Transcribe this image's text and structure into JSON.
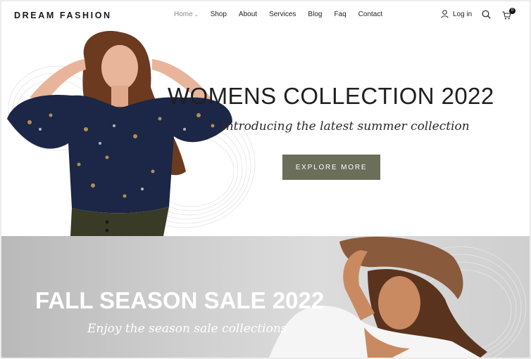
{
  "brand": {
    "name": "DREAM FASHION"
  },
  "nav": {
    "items": [
      {
        "label": "Home",
        "active": true
      },
      {
        "label": "Shop"
      },
      {
        "label": "About"
      },
      {
        "label": "Services"
      },
      {
        "label": "Blog"
      },
      {
        "label": "Faq"
      },
      {
        "label": "Contact"
      }
    ],
    "chevron": "⌄"
  },
  "header": {
    "login_label": "Log in",
    "cart_count": "0"
  },
  "hero": {
    "title": "WOMENS COLLECTION 2022",
    "subtitle": "Introducing the latest summer collection",
    "cta_label": "EXPLORE MORE"
  },
  "banner2": {
    "title": "FALL SEASON SALE 2022",
    "subtitle": "Enjoy the season sale collections"
  },
  "colors": {
    "accent": "#6b6e59",
    "text": "#1f1f1f",
    "muted": "#8a8a8a"
  },
  "icons": [
    "user-icon",
    "search-icon",
    "cart-icon"
  ]
}
